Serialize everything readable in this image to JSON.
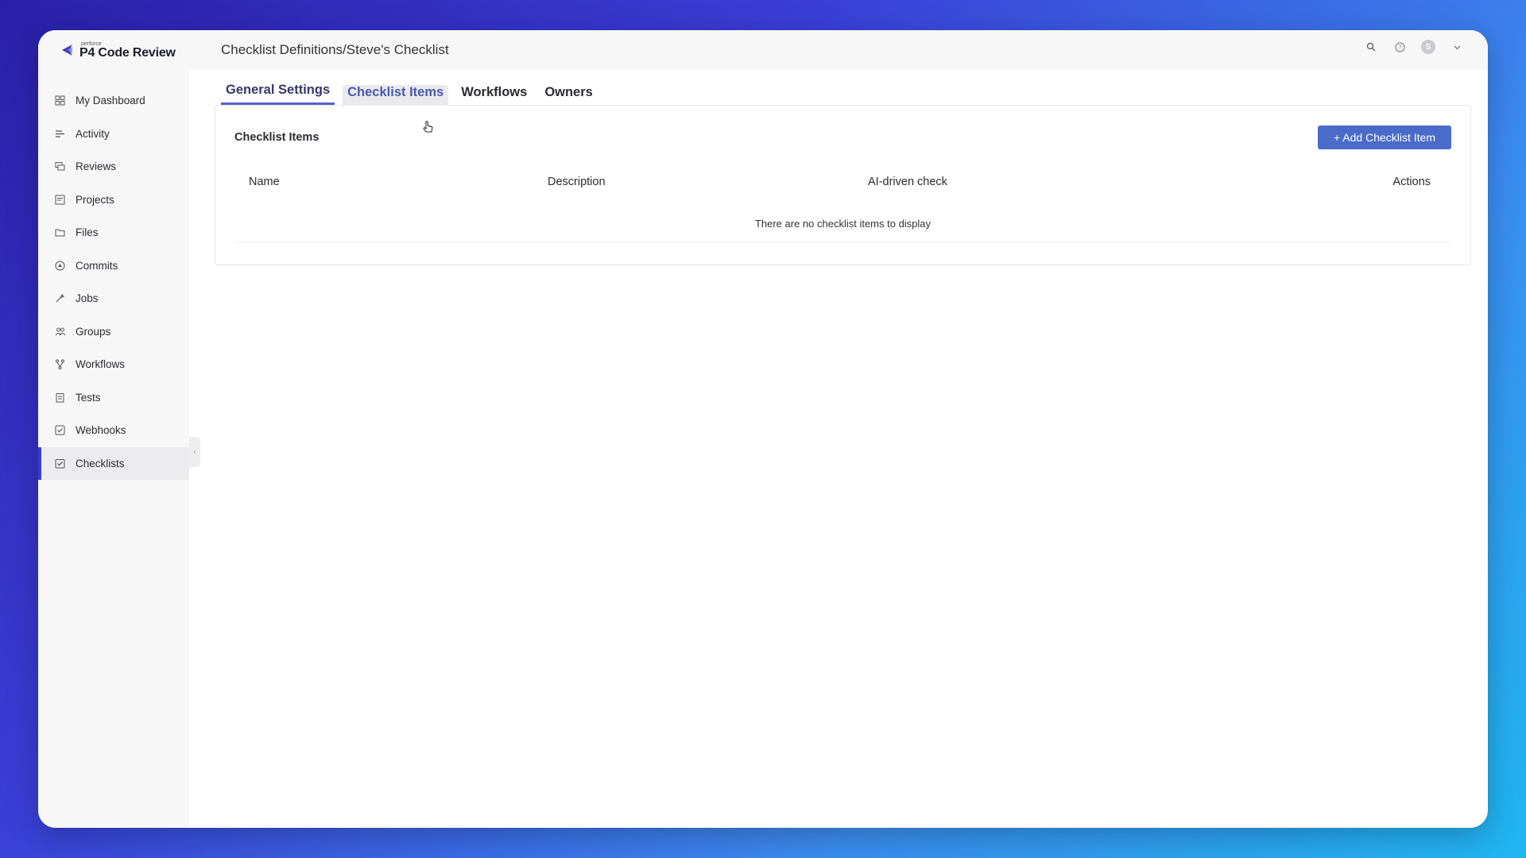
{
  "brand": {
    "small": "perforce",
    "name": "P4 Code Review"
  },
  "header": {
    "title": "Checklist Definitions/Steve's Checklist"
  },
  "sidebar": {
    "items": [
      {
        "label": "My Dashboard",
        "icon": "dashboard-icon"
      },
      {
        "label": "Activity",
        "icon": "activity-icon"
      },
      {
        "label": "Reviews",
        "icon": "reviews-icon"
      },
      {
        "label": "Projects",
        "icon": "projects-icon"
      },
      {
        "label": "Files",
        "icon": "folder-icon"
      },
      {
        "label": "Commits",
        "icon": "commits-icon"
      },
      {
        "label": "Jobs",
        "icon": "jobs-icon"
      },
      {
        "label": "Groups",
        "icon": "groups-icon"
      },
      {
        "label": "Workflows",
        "icon": "workflows-icon"
      },
      {
        "label": "Tests",
        "icon": "tests-icon"
      },
      {
        "label": "Webhooks",
        "icon": "webhooks-icon"
      },
      {
        "label": "Checklists",
        "icon": "checklists-icon",
        "active": true
      }
    ]
  },
  "tabs": [
    {
      "label": "General Settings",
      "selected": true
    },
    {
      "label": "Checklist Items",
      "hover": true
    },
    {
      "label": "Workflows"
    },
    {
      "label": "Owners"
    }
  ],
  "panel": {
    "title": "Checklist Items",
    "add_button": "+ Add Checklist Item",
    "columns": [
      "Name",
      "Description",
      "AI-driven check",
      "Actions"
    ],
    "empty_message": "There are no checklist items to display"
  },
  "user": {
    "avatar_initial": "S"
  },
  "colors": {
    "accent": "#3b3bd1",
    "button": "#4a6bc9",
    "tab_underline": "#5563c9"
  }
}
